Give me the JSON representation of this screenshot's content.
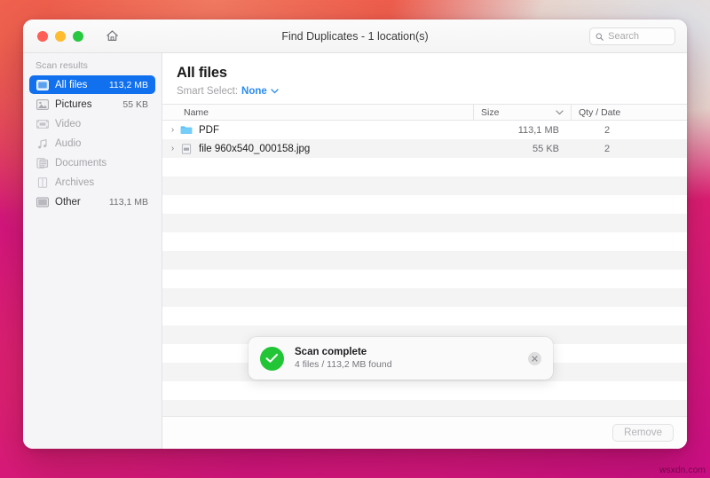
{
  "window": {
    "title": "Find Duplicates - 1 location(s)",
    "home_icon": "home-icon",
    "traffic_lights": [
      "close",
      "minimize",
      "zoom"
    ]
  },
  "search": {
    "placeholder": "Search",
    "value": "",
    "icon": "search-icon"
  },
  "sidebar": {
    "header": "Scan results",
    "items": [
      {
        "label": "All files",
        "size": "113,2 MB",
        "icon": "all-files-icon",
        "selected": true,
        "enabled": true
      },
      {
        "label": "Pictures",
        "size": "55 KB",
        "icon": "pictures-icon",
        "selected": false,
        "enabled": true
      },
      {
        "label": "Video",
        "size": "",
        "icon": "video-icon",
        "selected": false,
        "enabled": false
      },
      {
        "label": "Audio",
        "size": "",
        "icon": "audio-icon",
        "selected": false,
        "enabled": false
      },
      {
        "label": "Documents",
        "size": "",
        "icon": "documents-icon",
        "selected": false,
        "enabled": false
      },
      {
        "label": "Archives",
        "size": "",
        "icon": "archives-icon",
        "selected": false,
        "enabled": false
      },
      {
        "label": "Other",
        "size": "113,1 MB",
        "icon": "other-icon",
        "selected": false,
        "enabled": true
      }
    ]
  },
  "main": {
    "title": "All files",
    "smart_select_label": "Smart Select:",
    "smart_select_value": "None",
    "columns": {
      "name": "Name",
      "size": "Size",
      "qty": "Qty / Date"
    },
    "rows": [
      {
        "name": "PDF",
        "size": "113,1 MB",
        "qty": "2",
        "icon": "folder-icon",
        "expandable": true
      },
      {
        "name": "file 960x540_000158.jpg",
        "size": "55 KB",
        "qty": "2",
        "icon": "image-file-icon",
        "expandable": true
      }
    ],
    "empty_row_count": 14
  },
  "toast": {
    "title": "Scan complete",
    "subtitle": "4 files / 113,2 MB found",
    "status_icon": "checkmark-icon",
    "close_icon": "close-icon",
    "accent_color": "#22c536"
  },
  "footer": {
    "remove_label": "Remove",
    "remove_enabled": false
  },
  "watermark": "wsxdn.com",
  "theme": {
    "accent": "#1070ee",
    "link": "#2b8cf0",
    "success": "#22c536"
  }
}
